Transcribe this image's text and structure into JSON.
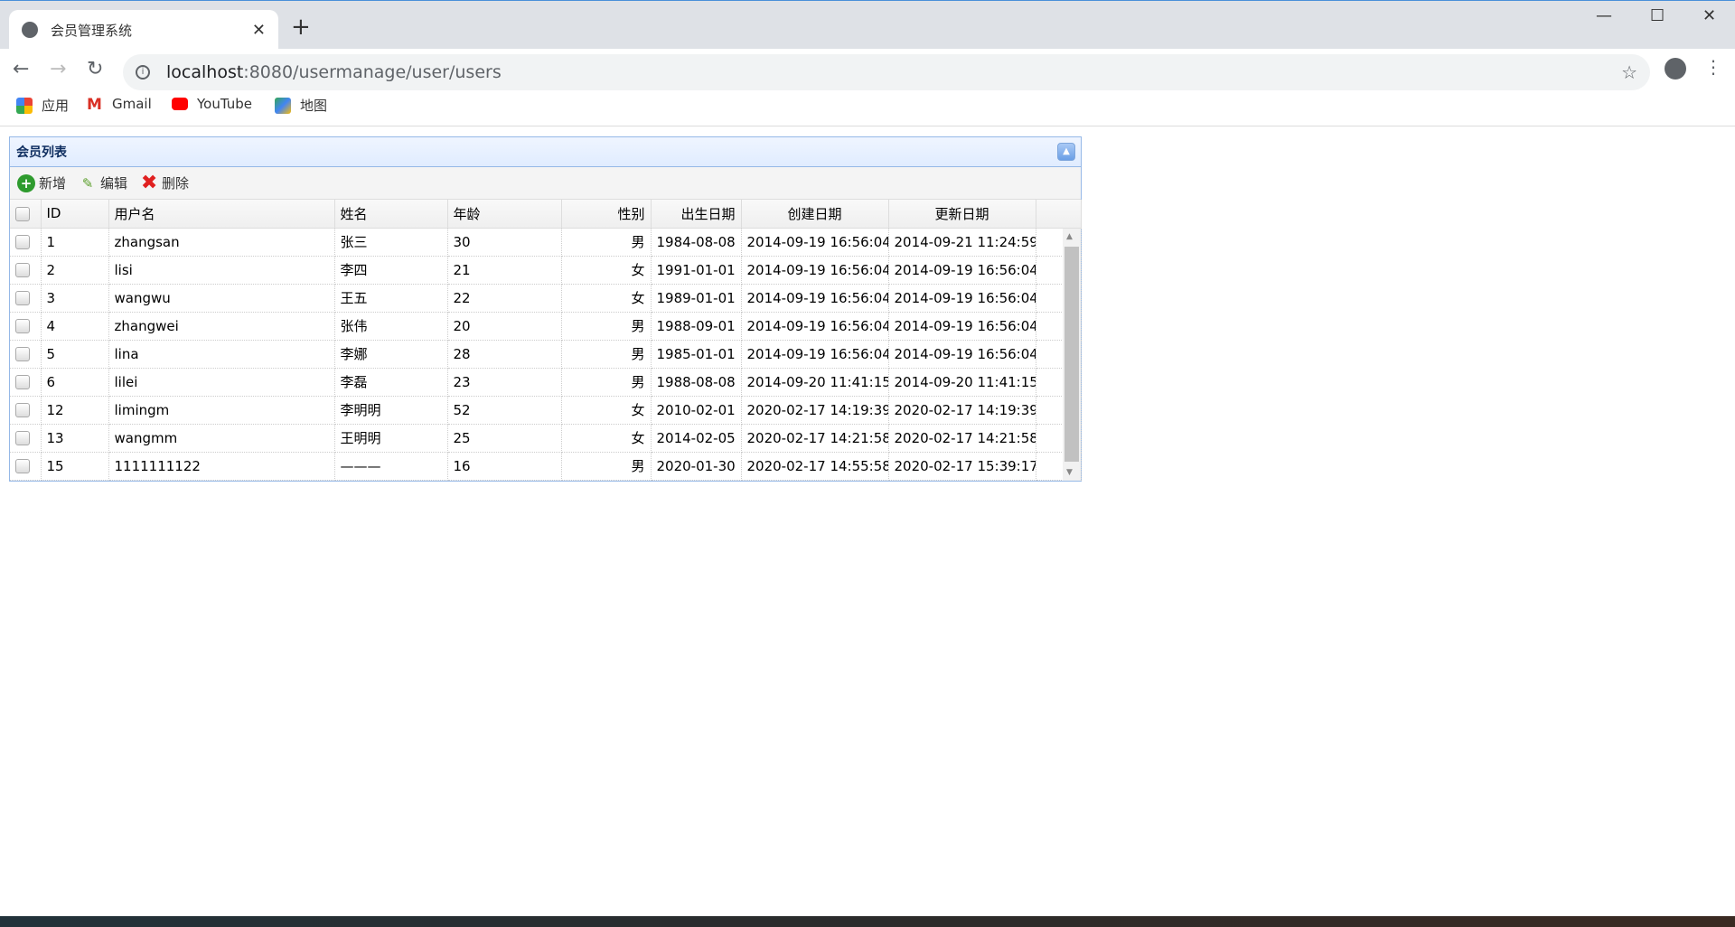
{
  "browser": {
    "tab_title": "会员管理系统",
    "url_host": "localhost",
    "url_path": ":8080/usermanage/user/users",
    "bookmarks": [
      {
        "label": "应用",
        "icon": "apps-grid-icon"
      },
      {
        "label": "Gmail",
        "icon": "gmail-icon"
      },
      {
        "label": "YouTube",
        "icon": "youtube-icon"
      },
      {
        "label": "地图",
        "icon": "maps-icon"
      }
    ]
  },
  "panel": {
    "title": "会员列表",
    "toolbar": {
      "add": "新增",
      "edit": "编辑",
      "delete": "删除"
    },
    "columns": [
      "ID",
      "用户名",
      "姓名",
      "年龄",
      "性别",
      "出生日期",
      "创建日期",
      "更新日期"
    ],
    "rows": [
      [
        "1",
        "zhangsan",
        "张三",
        "30",
        "男",
        "1984-08-08",
        "2014-09-19 16:56:04",
        "2014-09-21 11:24:59"
      ],
      [
        "2",
        "lisi",
        "李四",
        "21",
        "女",
        "1991-01-01",
        "2014-09-19 16:56:04",
        "2014-09-19 16:56:04"
      ],
      [
        "3",
        "wangwu",
        "王五",
        "22",
        "女",
        "1989-01-01",
        "2014-09-19 16:56:04",
        "2014-09-19 16:56:04"
      ],
      [
        "4",
        "zhangwei",
        "张伟",
        "20",
        "男",
        "1988-09-01",
        "2014-09-19 16:56:04",
        "2014-09-19 16:56:04"
      ],
      [
        "5",
        "lina",
        "李娜",
        "28",
        "男",
        "1985-01-01",
        "2014-09-19 16:56:04",
        "2014-09-19 16:56:04"
      ],
      [
        "6",
        "lilei",
        "李磊",
        "23",
        "男",
        "1988-08-08",
        "2014-09-20 11:41:15",
        "2014-09-20 11:41:15"
      ],
      [
        "12",
        "limingm",
        "李明明",
        "52",
        "女",
        "2010-02-01",
        "2020-02-17 14:19:39",
        "2020-02-17 14:19:39"
      ],
      [
        "13",
        "wangmm",
        "王明明",
        "25",
        "女",
        "2014-02-05",
        "2020-02-17 14:21:58",
        "2020-02-17 14:21:58"
      ],
      [
        "15",
        "1111111122",
        "———",
        "16",
        "男",
        "2020-01-30",
        "2020-02-17 14:55:58",
        "2020-02-17 15:39:17"
      ]
    ]
  }
}
